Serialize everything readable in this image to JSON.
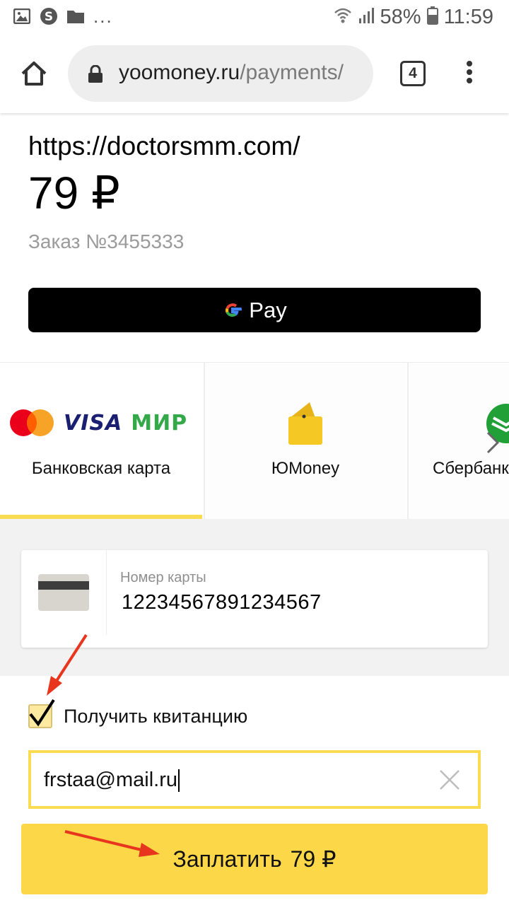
{
  "status_bar": {
    "battery_percent": "58%",
    "time": "11:59",
    "more_indicator": "..."
  },
  "browser": {
    "url_host": "yoomoney.ru",
    "url_path": "/payments/",
    "tab_count": "4"
  },
  "payment": {
    "merchant": "https://doctorsmm.com/",
    "amount": "79 ₽",
    "order": "Заказ №3455333"
  },
  "google_pay": {
    "label": "Pay"
  },
  "methods": [
    {
      "label": "Банковская карта",
      "logos": [
        "mastercard-logo",
        "VISA",
        "МИР"
      ],
      "selected": true
    },
    {
      "label": "ЮMoney",
      "icon": "wallet-icon",
      "selected": false
    },
    {
      "label": "Сбербанк",
      "icon": "sber-logo",
      "selected": false
    }
  ],
  "card": {
    "label": "Номер карты",
    "value": "12234567891234567"
  },
  "receipt": {
    "checkbox_label": "Получить квитанцию",
    "checked": true,
    "email_value": "frstaa@mail.ru"
  },
  "pay_button": {
    "label": "Заплатить",
    "amount": "79 ₽"
  },
  "colors": {
    "accent_yellow": "#fcd849",
    "annotation_arrow": "#e8361e",
    "mir_green": "#33a94a",
    "visa_blue": "#1a1f71"
  }
}
